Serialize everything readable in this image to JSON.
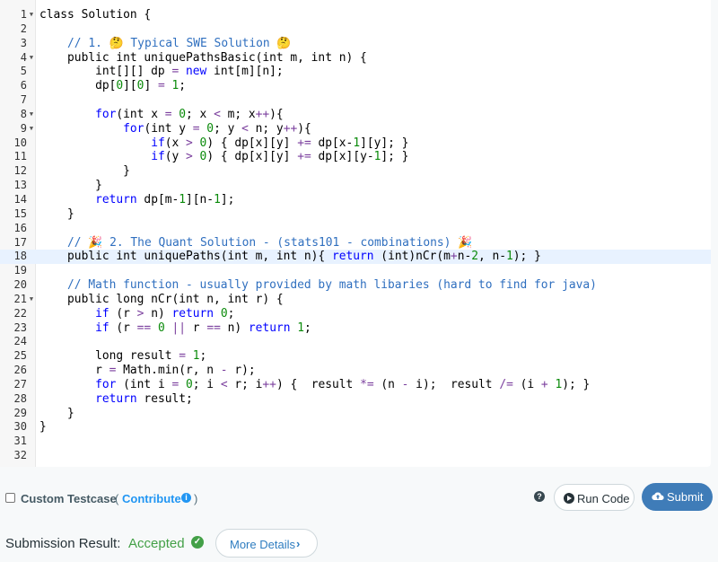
{
  "editor": {
    "active_line": 18,
    "lines": [
      {
        "n": "1",
        "fold": true,
        "tokens": [
          [
            "kw-",
            "class Solution {"
          ]
        ]
      },
      {
        "n": "2",
        "fold": false,
        "tokens": []
      },
      {
        "n": "3",
        "fold": false,
        "tokens": [
          [
            "",
            "    "
          ],
          [
            "cm",
            "// 1. 🤔 Typical SWE Solution 🤔"
          ]
        ]
      },
      {
        "n": "4",
        "fold": true,
        "tokens": [
          [
            "",
            "    public int uniquePathsBasic(int m, int n) {"
          ]
        ]
      },
      {
        "n": "5",
        "fold": false,
        "tokens": [
          [
            "",
            "        int[][] dp "
          ],
          [
            "op",
            "="
          ],
          [
            "",
            " "
          ],
          [
            "kw",
            "new"
          ],
          [
            "",
            " int[m][n];"
          ]
        ]
      },
      {
        "n": "6",
        "fold": false,
        "tokens": [
          [
            "",
            "        dp["
          ],
          [
            "num",
            "0"
          ],
          [
            "",
            "]["
          ],
          [
            "num",
            "0"
          ],
          [
            "",
            "] "
          ],
          [
            "op",
            "="
          ],
          [
            "",
            " "
          ],
          [
            "num",
            "1"
          ],
          [
            "",
            ";"
          ]
        ]
      },
      {
        "n": "7",
        "fold": false,
        "tokens": []
      },
      {
        "n": "8",
        "fold": true,
        "tokens": [
          [
            "",
            "        "
          ],
          [
            "kw",
            "for"
          ],
          [
            "",
            "(int x "
          ],
          [
            "op",
            "="
          ],
          [
            "",
            " "
          ],
          [
            "num",
            "0"
          ],
          [
            "",
            "; x "
          ],
          [
            "op",
            "<"
          ],
          [
            "",
            " m; x"
          ],
          [
            "op",
            "++"
          ],
          [
            "",
            "){"
          ]
        ]
      },
      {
        "n": "9",
        "fold": true,
        "tokens": [
          [
            "",
            "            "
          ],
          [
            "kw",
            "for"
          ],
          [
            "",
            "(int y "
          ],
          [
            "op",
            "="
          ],
          [
            "",
            " "
          ],
          [
            "num",
            "0"
          ],
          [
            "",
            "; y "
          ],
          [
            "op",
            "<"
          ],
          [
            "",
            " n; y"
          ],
          [
            "op",
            "++"
          ],
          [
            "",
            "){"
          ]
        ]
      },
      {
        "n": "10",
        "fold": false,
        "tokens": [
          [
            "",
            "                "
          ],
          [
            "kw",
            "if"
          ],
          [
            "",
            "(x "
          ],
          [
            "op",
            ">"
          ],
          [
            "",
            " "
          ],
          [
            "num",
            "0"
          ],
          [
            "",
            ") { dp[x][y] "
          ],
          [
            "op",
            "+="
          ],
          [
            "",
            " dp[x-"
          ],
          [
            "num",
            "1"
          ],
          [
            "",
            "][y]; }"
          ]
        ]
      },
      {
        "n": "11",
        "fold": false,
        "tokens": [
          [
            "",
            "                "
          ],
          [
            "kw",
            "if"
          ],
          [
            "",
            "(y "
          ],
          [
            "op",
            ">"
          ],
          [
            "",
            " "
          ],
          [
            "num",
            "0"
          ],
          [
            "",
            ") { dp[x][y] "
          ],
          [
            "op",
            "+="
          ],
          [
            "",
            " dp[x][y-"
          ],
          [
            "num",
            "1"
          ],
          [
            "",
            "]; }"
          ]
        ]
      },
      {
        "n": "12",
        "fold": false,
        "tokens": [
          [
            "",
            "            }"
          ]
        ]
      },
      {
        "n": "13",
        "fold": false,
        "tokens": [
          [
            "",
            "        }"
          ]
        ]
      },
      {
        "n": "14",
        "fold": false,
        "tokens": [
          [
            "",
            "        "
          ],
          [
            "kw",
            "return"
          ],
          [
            "",
            " dp[m-"
          ],
          [
            "num",
            "1"
          ],
          [
            "",
            "][n-"
          ],
          [
            "num",
            "1"
          ],
          [
            "",
            "];"
          ]
        ]
      },
      {
        "n": "15",
        "fold": false,
        "tokens": [
          [
            "",
            "    }"
          ]
        ]
      },
      {
        "n": "16",
        "fold": false,
        "tokens": []
      },
      {
        "n": "17",
        "fold": false,
        "tokens": [
          [
            "",
            "    "
          ],
          [
            "cm",
            "// 🎉 2. The Quant Solution - (stats101 - combinations) 🎉"
          ]
        ]
      },
      {
        "n": "18",
        "fold": false,
        "tokens": [
          [
            "",
            "    public int uniquePaths(int m, int n){ "
          ],
          [
            "kw",
            "return"
          ],
          [
            "",
            " (int)nCr(m"
          ],
          [
            "op",
            "+"
          ],
          [
            "",
            "n-"
          ],
          [
            "num",
            "2"
          ],
          [
            "",
            ", n-"
          ],
          [
            "num",
            "1"
          ],
          [
            "",
            "); }"
          ]
        ]
      },
      {
        "n": "19",
        "fold": false,
        "tokens": []
      },
      {
        "n": "20",
        "fold": false,
        "tokens": [
          [
            "",
            "    "
          ],
          [
            "cm",
            "// Math function - usually provided by math libaries (hard to find for java)"
          ]
        ]
      },
      {
        "n": "21",
        "fold": true,
        "tokens": [
          [
            "",
            "    public long nCr(int n, int r) {"
          ]
        ]
      },
      {
        "n": "22",
        "fold": false,
        "tokens": [
          [
            "",
            "        "
          ],
          [
            "kw",
            "if"
          ],
          [
            "",
            " (r "
          ],
          [
            "op",
            ">"
          ],
          [
            "",
            " n) "
          ],
          [
            "kw",
            "return"
          ],
          [
            "",
            " "
          ],
          [
            "num",
            "0"
          ],
          [
            "",
            ";"
          ]
        ]
      },
      {
        "n": "23",
        "fold": false,
        "tokens": [
          [
            "",
            "        "
          ],
          [
            "kw",
            "if"
          ],
          [
            "",
            " (r "
          ],
          [
            "op",
            "=="
          ],
          [
            "",
            " "
          ],
          [
            "num",
            "0"
          ],
          [
            "",
            " "
          ],
          [
            "op",
            "||"
          ],
          [
            "",
            " r "
          ],
          [
            "op",
            "=="
          ],
          [
            "",
            " n) "
          ],
          [
            "kw",
            "return"
          ],
          [
            "",
            " "
          ],
          [
            "num",
            "1"
          ],
          [
            "",
            ";"
          ]
        ]
      },
      {
        "n": "24",
        "fold": false,
        "tokens": []
      },
      {
        "n": "25",
        "fold": false,
        "tokens": [
          [
            "",
            "        long result "
          ],
          [
            "op",
            "="
          ],
          [
            "",
            " "
          ],
          [
            "num",
            "1"
          ],
          [
            "",
            ";"
          ]
        ]
      },
      {
        "n": "26",
        "fold": false,
        "tokens": [
          [
            "",
            "        r "
          ],
          [
            "op",
            "="
          ],
          [
            "",
            " Math.min(r, n "
          ],
          [
            "op",
            "-"
          ],
          [
            "",
            " r);"
          ]
        ]
      },
      {
        "n": "27",
        "fold": false,
        "tokens": [
          [
            "",
            "        "
          ],
          [
            "kw",
            "for"
          ],
          [
            "",
            " (int i "
          ],
          [
            "op",
            "="
          ],
          [
            "",
            " "
          ],
          [
            "num",
            "0"
          ],
          [
            "",
            "; i "
          ],
          [
            "op",
            "<"
          ],
          [
            "",
            " r; i"
          ],
          [
            "op",
            "++"
          ],
          [
            "",
            ") {  result "
          ],
          [
            "op",
            "*="
          ],
          [
            "",
            " (n "
          ],
          [
            "op",
            "-"
          ],
          [
            "",
            " i);  result "
          ],
          [
            "op",
            "/="
          ],
          [
            "",
            " (i "
          ],
          [
            "op",
            "+"
          ],
          [
            "",
            " "
          ],
          [
            "num",
            "1"
          ],
          [
            "",
            "); }"
          ]
        ]
      },
      {
        "n": "28",
        "fold": false,
        "tokens": [
          [
            "",
            "        "
          ],
          [
            "kw",
            "return"
          ],
          [
            "",
            " result;"
          ]
        ]
      },
      {
        "n": "29",
        "fold": false,
        "tokens": [
          [
            "",
            "    }"
          ]
        ]
      },
      {
        "n": "30",
        "fold": false,
        "tokens": [
          [
            "",
            "}"
          ]
        ]
      },
      {
        "n": "31",
        "fold": false,
        "tokens": []
      },
      {
        "n": "32",
        "fold": false,
        "tokens": []
      }
    ]
  },
  "testcase": {
    "label": "Custom Testcase",
    "open_paren": "(",
    "contribute_label": "Contribute",
    "close_paren": ")",
    "info_icon": "info-icon"
  },
  "toolbar": {
    "help_icon": "question-icon",
    "run_label": "Run Code",
    "run_icon": "play-icon",
    "submit_label": "Submit",
    "submit_icon": "cloud-upload-icon"
  },
  "result": {
    "label": "Submission Result:",
    "status": "Accepted",
    "status_icon": "check-circle-icon",
    "more_label": "More Details",
    "more_icon": "chevron-right-icon"
  },
  "colors": {
    "keyword": "#0000ff",
    "comment": "#2f6fbf",
    "number": "#0a8a0a",
    "accepted": "#43a047",
    "submit_bg": "#3f7cb8",
    "link": "#2196f3"
  }
}
